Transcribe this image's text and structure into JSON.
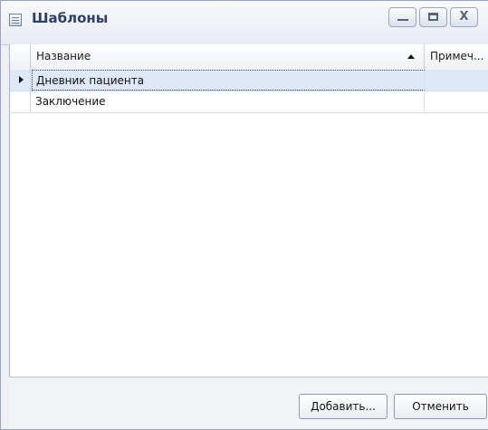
{
  "window": {
    "title": "Шаблоны",
    "controls": {
      "minimize": "",
      "maximize": "",
      "close": "X"
    }
  },
  "grid": {
    "columns": [
      {
        "label": "Название",
        "sort": "ascending"
      },
      {
        "label": "Примеч..."
      }
    ],
    "rows": [
      {
        "name": "Дневник пациента",
        "note": "",
        "current": true
      },
      {
        "name": "Заключение",
        "note": "",
        "current": false
      }
    ]
  },
  "footer": {
    "add_label": "Добавить...",
    "cancel_label": "Отменить"
  },
  "colors": {
    "selected_row": "#dfe8f6",
    "title_text": "#2d3f63"
  }
}
